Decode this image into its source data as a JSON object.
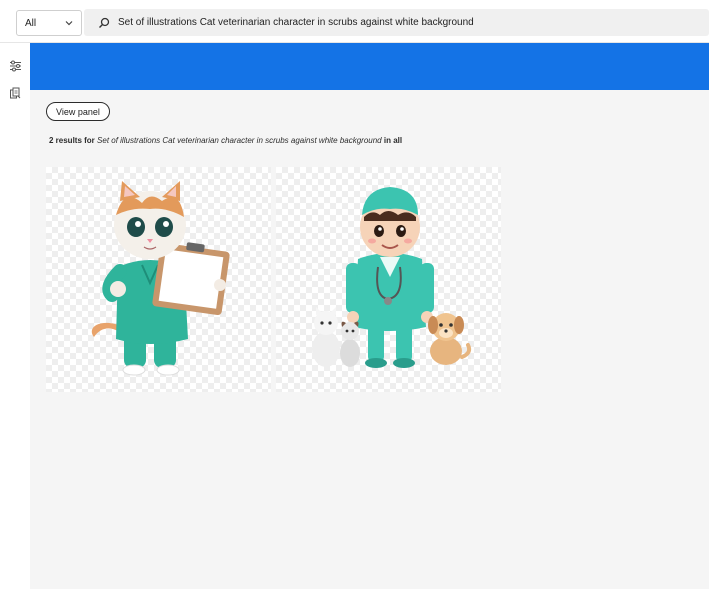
{
  "search": {
    "scope_label": "All",
    "query": "Set of illustrations Cat veterinarian character in scrubs against white background"
  },
  "toolbar": {
    "view_panel_label": "View panel"
  },
  "results": {
    "count_text": "2 results for",
    "query_text": "Set of illustrations Cat veterinarian character in scrubs against white background",
    "in_text": "in all"
  },
  "cards": [
    {
      "subject": "cat-vet-with-clipboard-illustration"
    },
    {
      "subject": "boy-vet-with-pets-illustration"
    }
  ],
  "colors": {
    "banner": "#1473e6",
    "scrubs": "#2fb49b",
    "background": "#f5f5f5"
  },
  "icons": {
    "rail_filter": "sliders-icon",
    "rail_library": "library-icon",
    "search": "search-icon",
    "scope": "chevron-down-icon"
  }
}
